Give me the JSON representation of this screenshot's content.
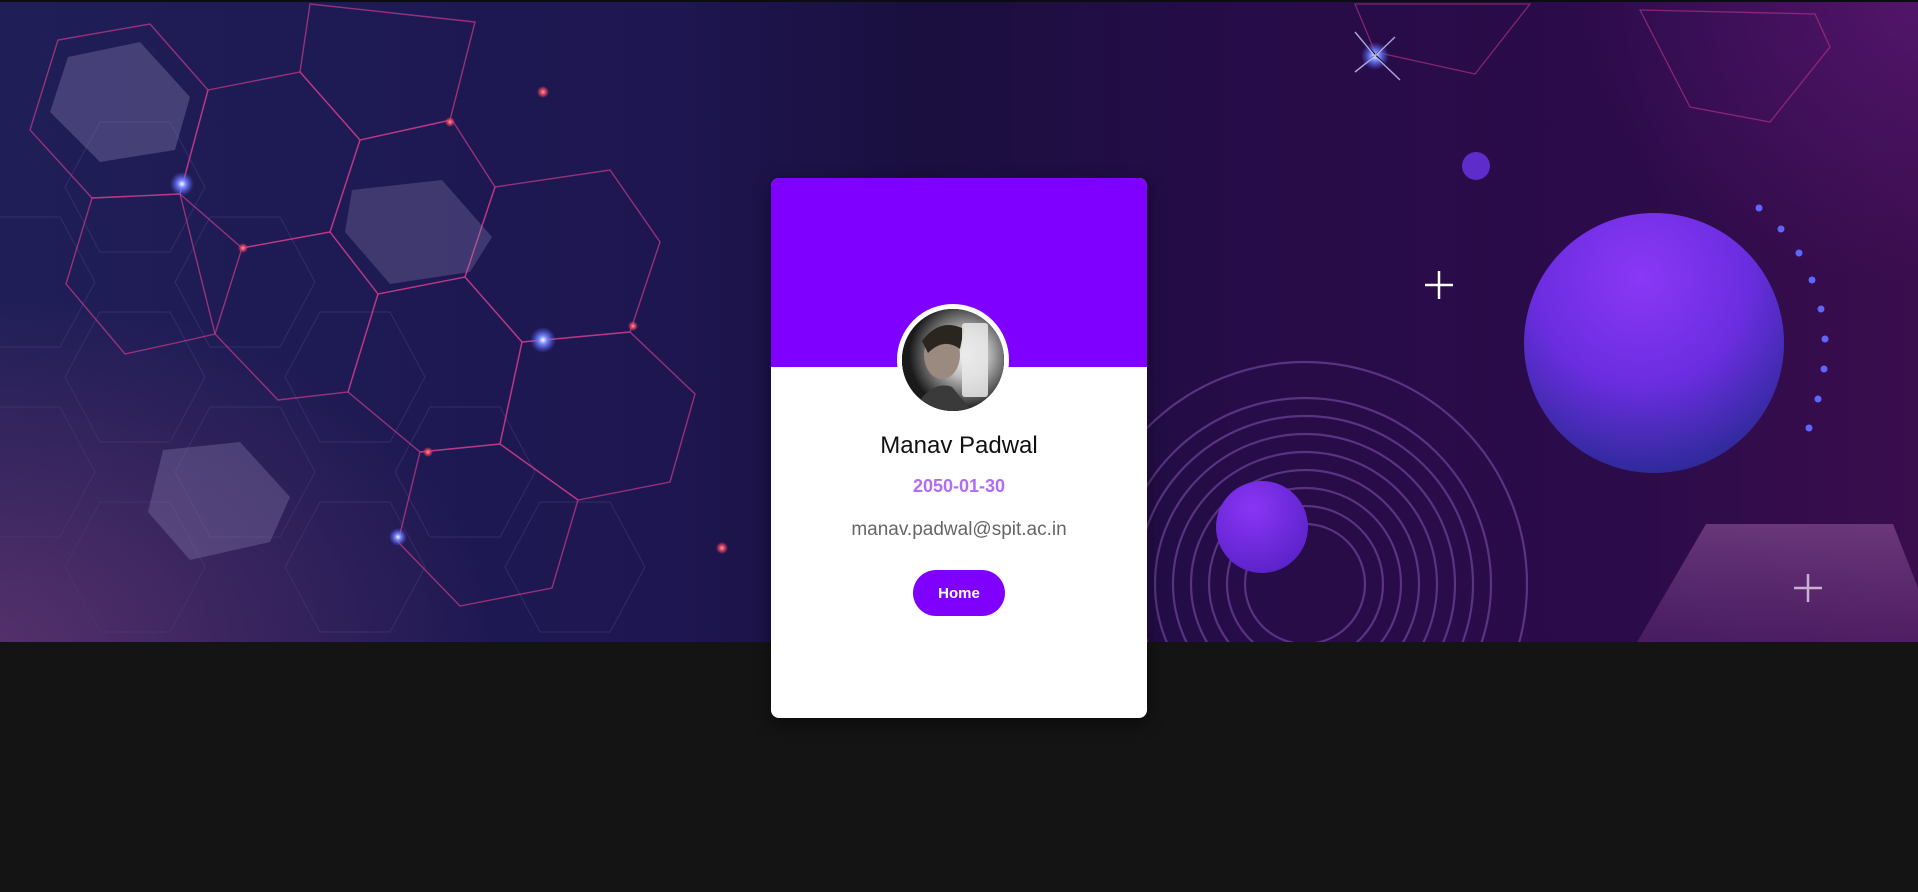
{
  "profile": {
    "name": "Manav Padwal",
    "dob": "2050-01-30",
    "email": "manav.padwal@spit.ac.in",
    "home_label": "Home",
    "avatar_icon": "user-photo"
  },
  "colors": {
    "accent": "#8000ff",
    "dob_text": "#b26cf4",
    "email_text": "#666666",
    "page_bottom": "#141414"
  }
}
